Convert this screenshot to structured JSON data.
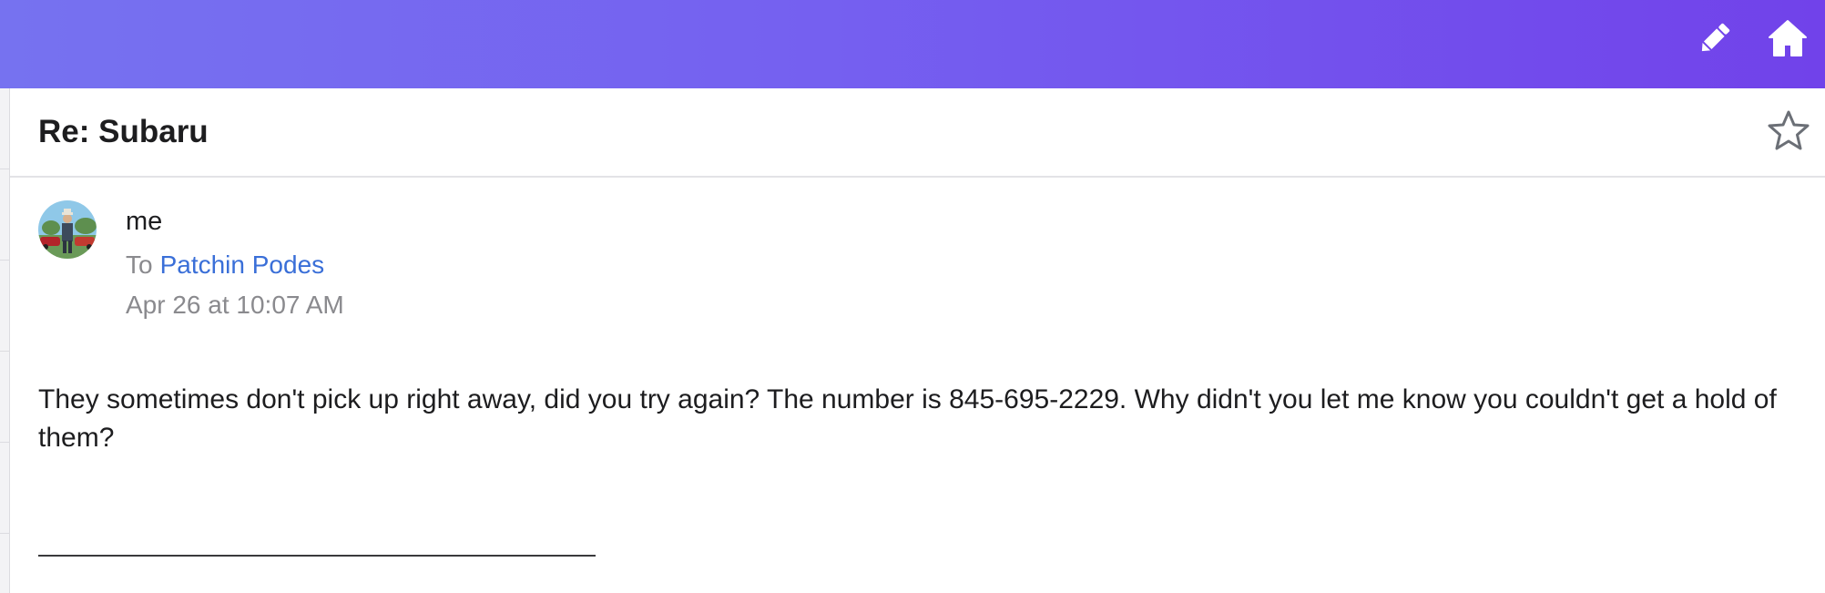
{
  "toolbar": {
    "compose_icon": "pencil-icon",
    "home_icon": "home-icon",
    "gradient": [
      "#7672f0",
      "#7142ea"
    ]
  },
  "message": {
    "subject": "Re: Subaru",
    "star_icon": "star-outline-icon",
    "sender": "me",
    "to_label": "To",
    "recipient": "Patchin Podes",
    "date": "Apr 26 at 10:07 AM",
    "body": "They sometimes don't pick up right away, did you try again? The number is 845-695-2229. Why didn't you let me know you couldn't get a hold of them?"
  },
  "colors": {
    "link": "#3a6fd8",
    "muted": "#8a8a8e",
    "text": "#1d1d1f"
  }
}
